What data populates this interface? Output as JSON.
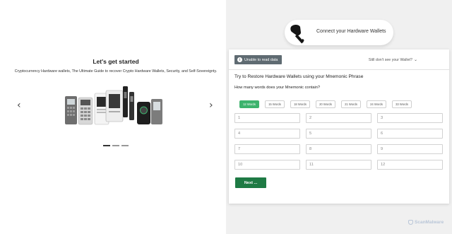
{
  "left": {
    "heading": "Let's get started",
    "subheading": "Cryptocurrency Hardware wallets, The Ultimate Guide to recover Crypto Hardware Wallets, Security, and Self-Sovereignty.",
    "prev_icon": "chevron-left-icon",
    "next_icon": "chevron-right-icon",
    "image": "hardware-wallets-devices",
    "carousel": {
      "slides": 3,
      "active": 1
    }
  },
  "connect": {
    "label": "Connect your Hardware Wallets",
    "icon": "usb-key-icon"
  },
  "card": {
    "badge": "Unable to read data",
    "still_text": "Still don't see your Wallet?",
    "question_title": "Try to Restore Hardware Wallets using your Mnemonic Phrase",
    "question_words": "How many words does your Mnemonic contain?",
    "word_options": [
      "12 Words",
      "15 Words",
      "18 Words",
      "20 Words",
      "21 Words",
      "24 Words",
      "33 Words"
    ],
    "selected_option": "12 Words",
    "fields": [
      "1",
      "2",
      "3",
      "4",
      "5",
      "6",
      "7",
      "8",
      "9",
      "10",
      "11",
      "12"
    ],
    "next_label": "Next ..."
  },
  "watermark": "ScanMalware",
  "colors": {
    "accent_green": "#3db36d",
    "button_green": "#1e7a44",
    "badge_gray": "#5f6b72",
    "right_panel_bg": "#f0f0f0"
  }
}
